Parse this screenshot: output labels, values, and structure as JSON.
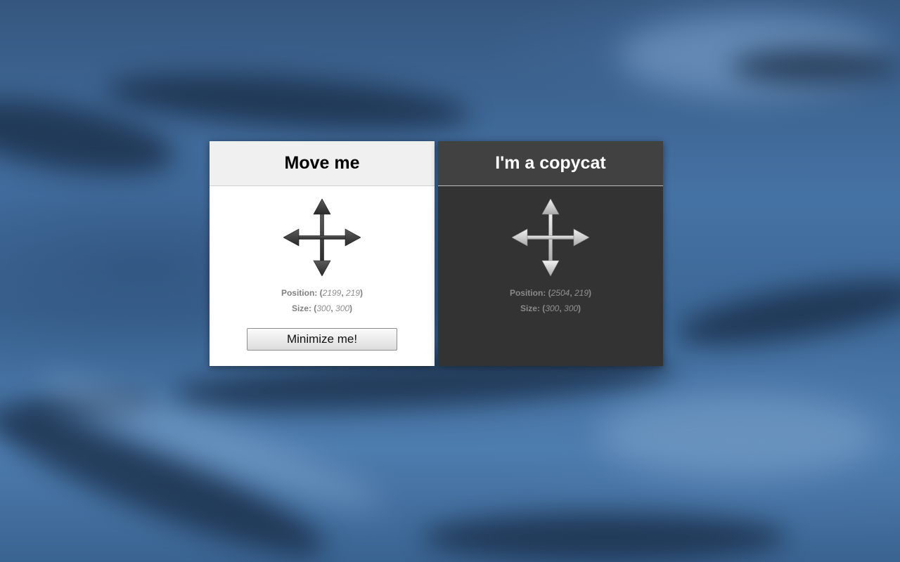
{
  "colors": {
    "desktop_background": "#3f6794",
    "light_panel": "#ffffff",
    "light_header": "#f0f0f0",
    "dark_panel": "#333333",
    "dark_header": "#414141"
  },
  "main_window": {
    "title": "Move me",
    "icon": "move-arrows-icon",
    "position_label": "Position:",
    "position_x": "2199",
    "position_y": "219",
    "size_label": "Size:",
    "size_w": "300",
    "size_h": "300",
    "minimize_button_label": "Minimize me!"
  },
  "copycat_window": {
    "title": "I'm a copycat",
    "icon": "move-arrows-icon",
    "position_label": "Position:",
    "position_x": "2504",
    "position_y": "219",
    "size_label": "Size:",
    "size_w": "300",
    "size_h": "300"
  }
}
